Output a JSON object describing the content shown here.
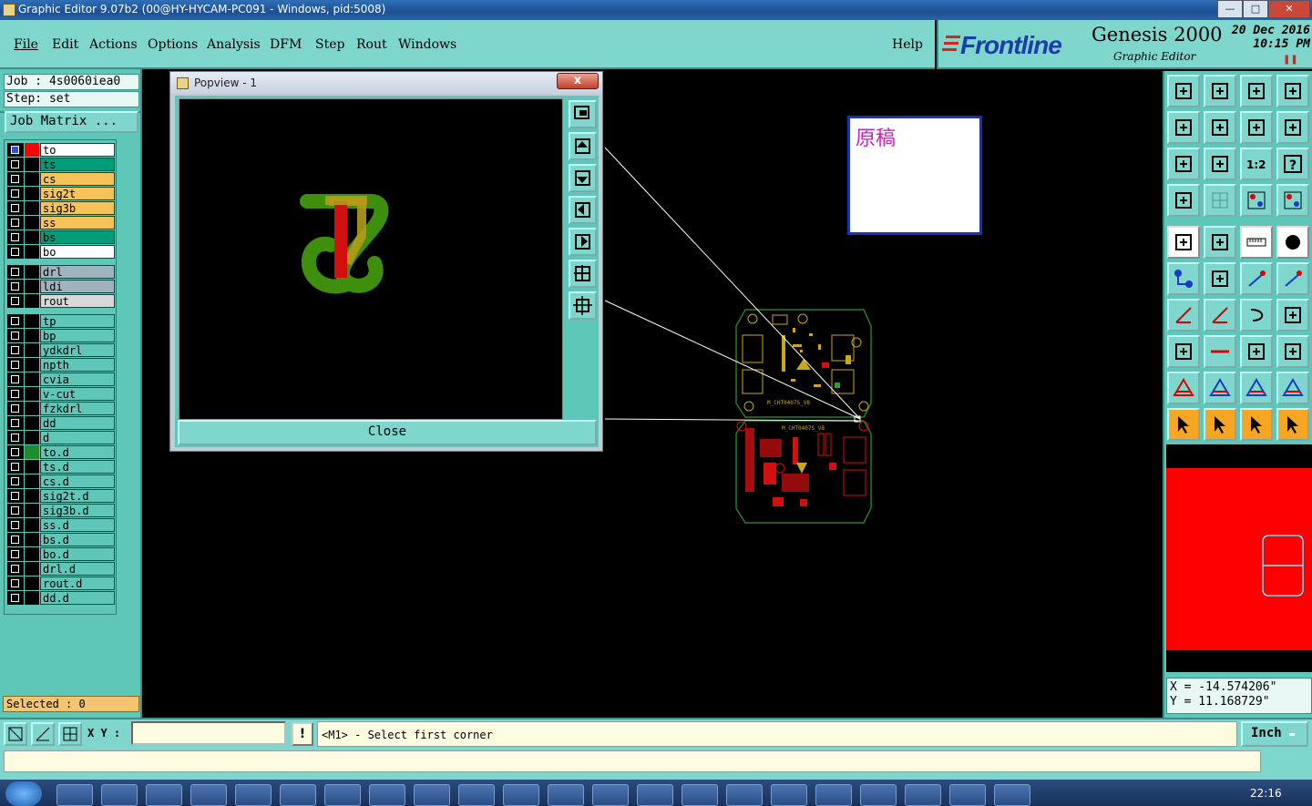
{
  "window": {
    "title": "Graphic Editor 9.07b2 (00@HY-HYCAM-PC091 - Windows, pid:5008)"
  },
  "menu": {
    "items": [
      "File",
      "Edit",
      "Actions",
      "Options",
      "Analysis",
      "DFM",
      "Step",
      "Rout",
      "Windows"
    ],
    "help": "Help"
  },
  "brand": {
    "logo": "Frontline",
    "product": "Genesis 2000",
    "subtitle": "Graphic Editor",
    "date": "20 Dec 2016",
    "time": "10:15 PM"
  },
  "job": {
    "job_line": "Job : 4s0060iea0",
    "step_line": "Step: set",
    "matrix_button": "Job Matrix ..."
  },
  "layers": [
    {
      "name": "to",
      "color": "#ffffff",
      "swatch": "#ff0000",
      "active": true
    },
    {
      "name": "ts",
      "color": "#009c7a",
      "swatch": "#000000"
    },
    {
      "name": "cs",
      "color": "#f6c35b",
      "swatch": "#000000"
    },
    {
      "name": "sig2t",
      "color": "#f6c35b",
      "swatch": "#000000"
    },
    {
      "name": "sig3b",
      "color": "#f6c35b",
      "swatch": "#000000"
    },
    {
      "name": "ss",
      "color": "#f6c35b",
      "swatch": "#000000"
    },
    {
      "name": "bs",
      "color": "#009c7a",
      "swatch": "#000000"
    },
    {
      "name": "bo",
      "color": "#ffffff",
      "swatch": "#000000"
    },
    {
      "name": "drl",
      "color": "#9fb3bd",
      "swatch": "#000000"
    },
    {
      "name": "ldi",
      "color": "#9fb3bd",
      "swatch": "#000000"
    },
    {
      "name": "rout",
      "color": "#d8d8d8",
      "swatch": "#000000"
    },
    {
      "name": "tp",
      "color": "#5ec7b7",
      "swatch": "#000000"
    },
    {
      "name": "bp",
      "color": "#5ec7b7",
      "swatch": "#000000"
    },
    {
      "name": "ydkdrl",
      "color": "#5ec7b7",
      "swatch": "#000000"
    },
    {
      "name": "npth",
      "color": "#5ec7b7",
      "swatch": "#000000"
    },
    {
      "name": "cvia",
      "color": "#5ec7b7",
      "swatch": "#000000"
    },
    {
      "name": "v-cut",
      "color": "#5ec7b7",
      "swatch": "#000000"
    },
    {
      "name": "fzkdrl",
      "color": "#5ec7b7",
      "swatch": "#000000"
    },
    {
      "name": "dd",
      "color": "#5ec7b7",
      "swatch": "#000000"
    },
    {
      "name": "d",
      "color": "#5ec7b7",
      "swatch": "#000000"
    },
    {
      "name": "to.d",
      "color": "#5ec7b7",
      "swatch": "#1f8c2a"
    },
    {
      "name": "ts.d",
      "color": "#5ec7b7",
      "swatch": "#000000"
    },
    {
      "name": "cs.d",
      "color": "#5ec7b7",
      "swatch": "#000000"
    },
    {
      "name": "sig2t.d",
      "color": "#5ec7b7",
      "swatch": "#000000"
    },
    {
      "name": "sig3b.d",
      "color": "#5ec7b7",
      "swatch": "#000000"
    },
    {
      "name": "ss.d",
      "color": "#5ec7b7",
      "swatch": "#000000"
    },
    {
      "name": "bs.d",
      "color": "#5ec7b7",
      "swatch": "#000000"
    },
    {
      "name": "bo.d",
      "color": "#5ec7b7",
      "swatch": "#000000"
    },
    {
      "name": "drl.d",
      "color": "#5ec7b7",
      "swatch": "#000000"
    },
    {
      "name": "rout.d",
      "color": "#5ec7b7",
      "swatch": "#000000"
    },
    {
      "name": "dd.d",
      "color": "#5ec7b7",
      "swatch": "#000000"
    }
  ],
  "selected": "Selected : 0",
  "popview": {
    "title": "Popview - 1",
    "close_x": "x",
    "close_button": "Close"
  },
  "note": {
    "text": "原稿"
  },
  "coords": {
    "x": "X = -14.574206\"",
    "y": "Y = 11.168729\""
  },
  "cmd": {
    "xy_label": "X Y :",
    "xy_value": "",
    "warn": "!",
    "prompt": "<M1> - Select first corner",
    "units": "Inch"
  },
  "taskbar": {
    "time": "22:16"
  },
  "tools": {
    "icons": [
      "home-up",
      "home-down",
      "home-house",
      "window-split",
      "move-left",
      "move-right",
      "swap-lr",
      "step-s",
      "fit-screen",
      "zoom-fit",
      "ratio-1-2",
      "help-question",
      "snap-tools",
      "grid",
      "measure-net",
      "measure-net-red",
      "contour-black",
      "pen-edit",
      "ruler",
      "circle-black",
      "pad-blue",
      "cross-blue",
      "line-redpoint",
      "line-redpoint-2",
      "angle-red",
      "slash-red",
      "arc-curve",
      "flip-red",
      "feature-add",
      "horiz-line",
      "center-measure",
      "shapes-blue",
      "triangle-red",
      "triangle-blue",
      "triangle-arrow",
      "triangle-arrow-2",
      "pointer",
      "pointer-select",
      "pointer-circle",
      "route-pointer"
    ]
  }
}
